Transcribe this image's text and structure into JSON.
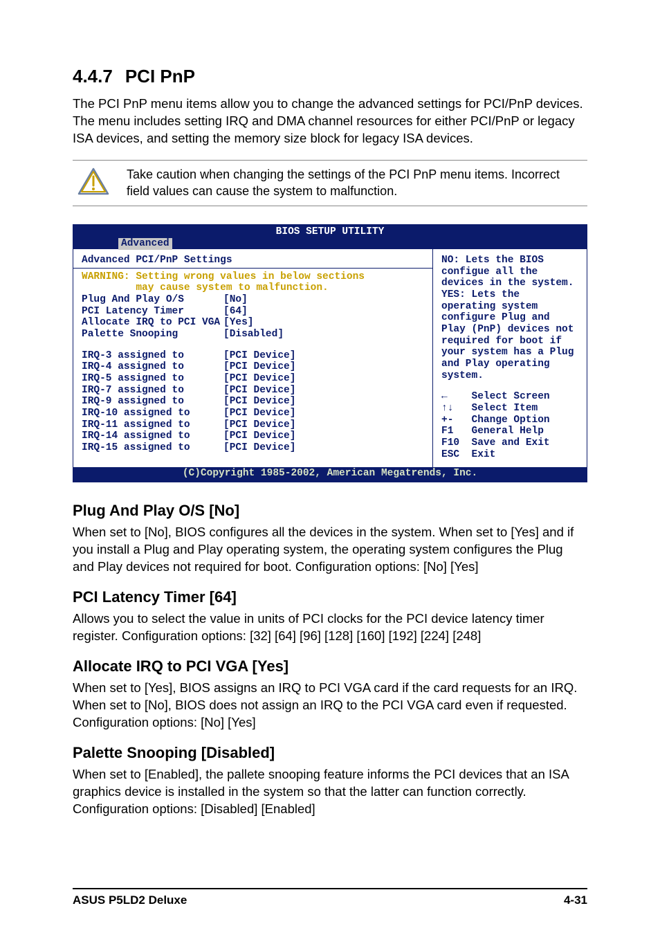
{
  "section": {
    "number": "4.4.7",
    "title": "PCI PnP"
  },
  "intro": "The PCI PnP menu items allow you to change the advanced settings for PCI/PnP devices. The menu includes setting IRQ and DMA channel resources for either PCI/PnP or legacy ISA devices, and setting the memory size block for legacy ISA devices.",
  "callout": "Take caution when changing the settings of the PCI PnP menu items. Incorrect field values can cause the system to malfunction.",
  "bios": {
    "utility_title": "BIOS SETUP UTILITY",
    "active_tab": "Advanced",
    "panel_title": "Advanced PCI/PnP Settings",
    "warning_text": "WARNING: Setting wrong values in below sections\n         may cause system to malfunction.",
    "options": [
      {
        "label": "Plug And Play O/S",
        "value": "[No]"
      },
      {
        "label": "PCI Latency Timer",
        "value": "[64]"
      },
      {
        "label": "Allocate IRQ to PCI VGA",
        "value": "[Yes]"
      },
      {
        "label": "Palette Snooping",
        "value": "[Disabled]"
      }
    ],
    "irq": [
      {
        "label": "IRQ-3 assigned to",
        "value": "[PCI Device]"
      },
      {
        "label": "IRQ-4 assigned to",
        "value": "[PCI Device]"
      },
      {
        "label": "IRQ-5 assigned to",
        "value": "[PCI Device]"
      },
      {
        "label": "IRQ-7 assigned to",
        "value": "[PCI Device]"
      },
      {
        "label": "IRQ-9 assigned to",
        "value": "[PCI Device]"
      },
      {
        "label": "IRQ-10 assigned to",
        "value": "[PCI Device]"
      },
      {
        "label": "IRQ-11 assigned to",
        "value": "[PCI Device]"
      },
      {
        "label": "IRQ-14 assigned to",
        "value": "[PCI Device]"
      },
      {
        "label": "IRQ-15 assigned to",
        "value": "[PCI Device]"
      }
    ],
    "help_text": "NO: Lets the BIOS configue all the devices in the system. YES: Lets the operating system configure Plug and Play (PnP) devices not required for boot if your system has a Plug and Play operating system.",
    "nav": [
      "←    Select Screen",
      "↑↓   Select Item",
      "+-   Change Option",
      "F1   General Help",
      "F10  Save and Exit",
      "ESC  Exit"
    ],
    "copyright": "(C)Copyright 1985-2002, American Megatrends, Inc."
  },
  "items": [
    {
      "heading": "Plug And Play O/S [No]",
      "body": "When set to [No], BIOS configures all the devices in the system. When set to [Yes] and if you install a Plug and Play operating system, the operating system configures the Plug and Play devices not required for boot. Configuration options: [No] [Yes]"
    },
    {
      "heading": "PCI Latency Timer [64]",
      "body": "Allows you to select the value in units of PCI clocks for the PCI device latency timer register. Configuration options: [32] [64] [96] [128] [160] [192] [224] [248]"
    },
    {
      "heading": "Allocate IRQ to PCI VGA [Yes]",
      "body": "When set to [Yes], BIOS assigns an IRQ to PCI VGA card if the card requests for an IRQ. When set to [No], BIOS does not assign an IRQ to the PCI VGA card even if requested. Configuration options: [No] [Yes]"
    },
    {
      "heading": "Palette Snooping [Disabled]",
      "body": "When set to [Enabled], the pallete snooping feature informs the PCI devices that an ISA graphics device is installed in the system so that the latter can function correctly. Configuration options: [Disabled] [Enabled]"
    }
  ],
  "footer": {
    "left": "ASUS P5LD2 Deluxe",
    "right": "4-31"
  }
}
